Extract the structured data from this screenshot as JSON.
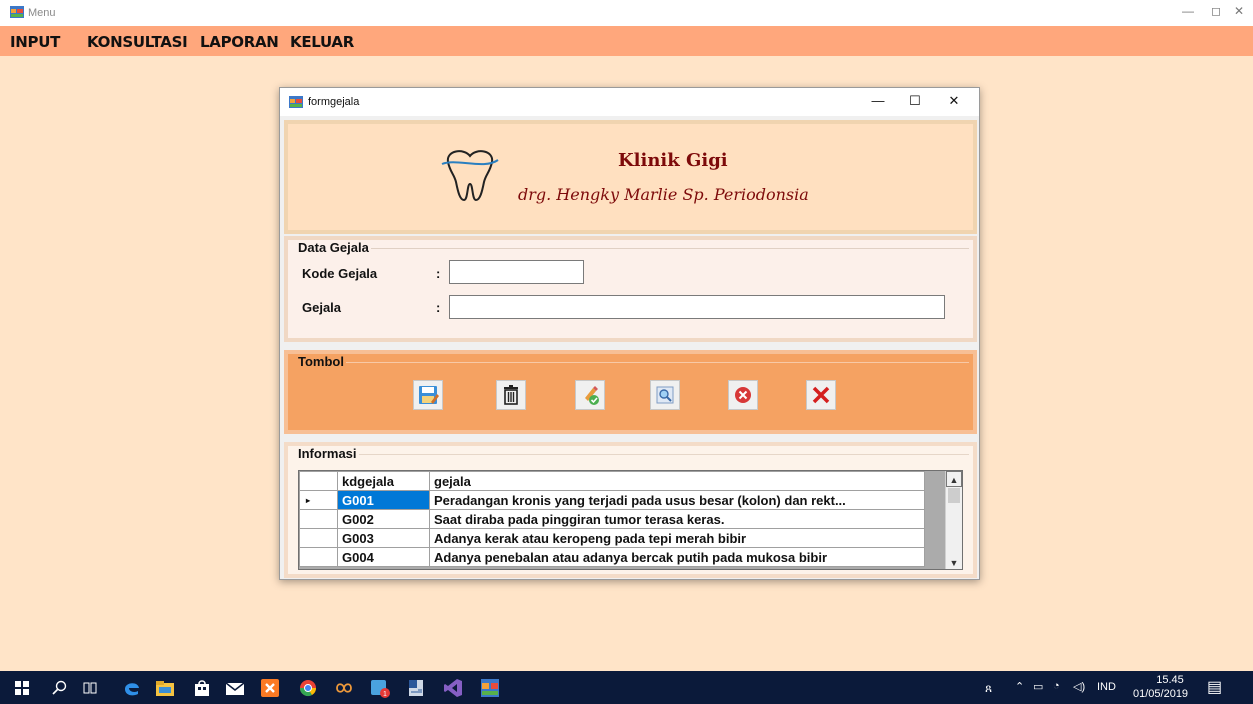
{
  "window": {
    "title": "Menu",
    "controls": [
      "—",
      "◻",
      "✕"
    ]
  },
  "menubar": {
    "items": [
      "INPUT",
      "KONSULTASI",
      "LAPORAN",
      "KELUAR"
    ]
  },
  "form": {
    "title": "formgejala",
    "controls": [
      "—",
      "☐",
      "✕"
    ],
    "banner": {
      "clinic_name": "Klinik Gigi",
      "doctor_name": "drg. Hengky Marlie Sp. Periodonsia"
    },
    "data_group": {
      "legend": "Data Gejala",
      "kode_label": "Kode Gejala",
      "gejala_label": "Gejala",
      "colon": ":",
      "kode_value": "",
      "gejala_value": ""
    },
    "button_group": {
      "legend": "Tombol",
      "buttons": [
        "save-icon",
        "delete-icon",
        "edit-icon",
        "search-icon",
        "cancel-icon",
        "close-icon"
      ]
    },
    "info_group": {
      "legend": "Informasi",
      "columns": [
        "kdgejala",
        "gejala"
      ],
      "rows": [
        [
          "G001",
          "Peradangan kronis yang terjadi pada usus besar (kolon) dan rekt..."
        ],
        [
          "G002",
          "Saat diraba pada pinggiran tumor terasa keras."
        ],
        [
          "G003",
          "Adanya kerak atau keropeng pada tepi merah bibir"
        ],
        [
          "G004",
          "Adanya penebalan atau adanya bercak putih pada mukosa bibir"
        ]
      ],
      "selected_row_marker": "▸"
    }
  },
  "taskbar": {
    "tray": {
      "lang": "IND",
      "time": "15.45",
      "date": "01/05/2019"
    },
    "colors": {
      "background": "#0b1a3a"
    }
  },
  "colors": {
    "menubar": "#ffa77c",
    "desktop": "#ffe4c8",
    "banner_text": "#7d0a0a",
    "button_group": "#f5a262",
    "selection": "#0078d7"
  }
}
